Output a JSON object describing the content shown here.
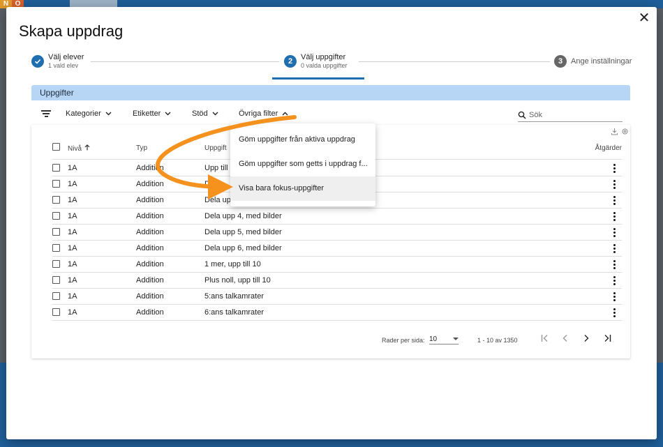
{
  "background": {
    "logo_letter_1": "N",
    "logo_letter_2": "O"
  },
  "modal": {
    "title": "Skapa uppdrag",
    "close_icon": "close-icon"
  },
  "stepper": {
    "steps": [
      {
        "number": "1",
        "title": "Välj elever",
        "subtitle": "1 vald elev",
        "state": "done"
      },
      {
        "number": "2",
        "title": "Välj uppgifter",
        "subtitle": "0 valda uppgifter",
        "state": "active"
      },
      {
        "number": "3",
        "title": "Ange inställningar",
        "subtitle": "",
        "state": "todo"
      }
    ]
  },
  "section": {
    "title": "Uppgifter"
  },
  "filters": {
    "items": [
      {
        "label": "Kategorier",
        "icon": "chevron-down-icon"
      },
      {
        "label": "Etiketter",
        "icon": "chevron-down-icon"
      },
      {
        "label": "Stöd",
        "icon": "chevron-down-icon"
      },
      {
        "label": "Övriga filter",
        "icon": "chevron-up-icon"
      }
    ],
    "search_placeholder": "Sök"
  },
  "dropdown": {
    "items": [
      "Göm uppgifter från aktiva uppdrag",
      "Göm uppgifter som getts i uppdrag f...",
      "Visa bara fokus-uppgifter"
    ]
  },
  "table": {
    "columns": {
      "level": "Nivå",
      "type": "Typ",
      "task": "Uppgift",
      "actions": "Åtgärder"
    },
    "rows": [
      {
        "level": "1A",
        "type": "Addition",
        "task": "Upp till"
      },
      {
        "level": "1A",
        "type": "Addition",
        "task": "Dela"
      },
      {
        "level": "1A",
        "type": "Addition",
        "task": "Dela upp"
      },
      {
        "level": "1A",
        "type": "Addition",
        "task": "Dela upp 4, med bilder"
      },
      {
        "level": "1A",
        "type": "Addition",
        "task": "Dela upp 5, med bilder"
      },
      {
        "level": "1A",
        "type": "Addition",
        "task": "Dela upp 6, med bilder"
      },
      {
        "level": "1A",
        "type": "Addition",
        "task": "1 mer, upp till 10"
      },
      {
        "level": "1A",
        "type": "Addition",
        "task": "Plus noll, upp till 10"
      },
      {
        "level": "1A",
        "type": "Addition",
        "task": "5:ans talkamrater"
      },
      {
        "level": "1A",
        "type": "Addition",
        "task": "6:ans talkamrater"
      }
    ]
  },
  "pagination": {
    "rows_per_page_label": "Rader per sida:",
    "rows_per_page_value": "10",
    "range_text": "1 - 10 av 1350"
  },
  "colors": {
    "primary": "#1f6fb0",
    "section_bar": "#b7d5f5",
    "arrow": "#f5921e"
  }
}
